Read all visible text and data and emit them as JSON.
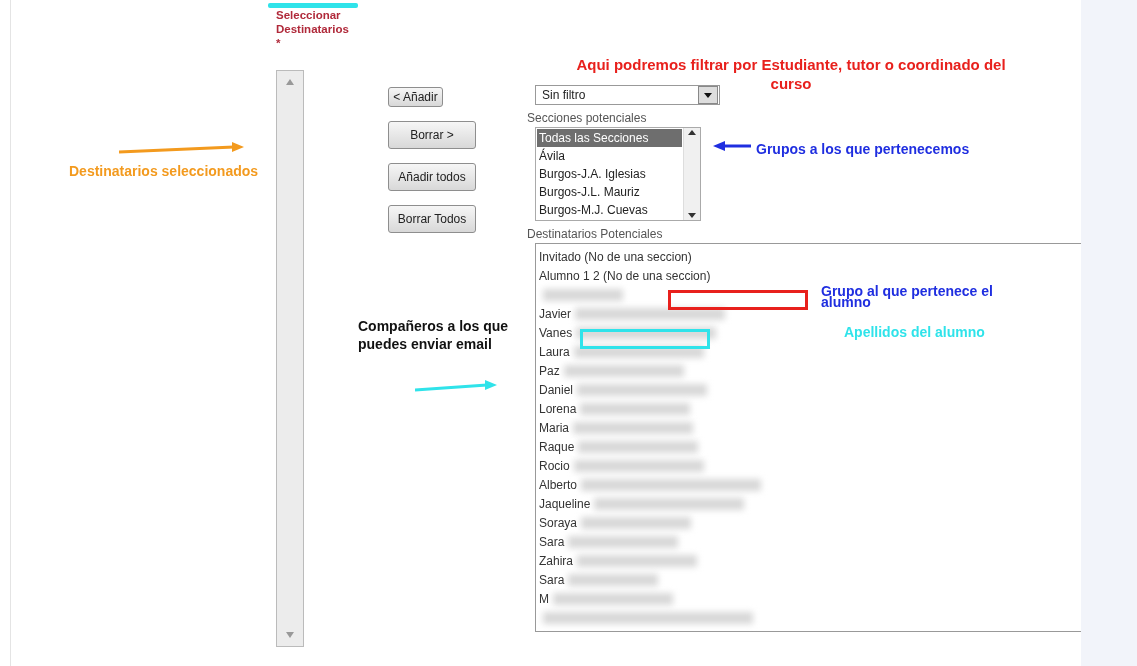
{
  "recipients_title": {
    "text": "Seleccionar Destinatarios",
    "required_mark": "*"
  },
  "selected_recipients": {
    "kind": "empty-list"
  },
  "buttons": [
    {
      "label": "< Añadir",
      "kind": "compact"
    },
    {
      "label": "Borrar >",
      "kind": "wide"
    },
    {
      "label": "Añadir todos",
      "kind": "wide"
    },
    {
      "label": "Borrar Todos",
      "kind": "wide"
    }
  ],
  "filter": {
    "value": "Sin filtro"
  },
  "sections_label": "Secciones potenciales",
  "sections": [
    {
      "label": "Todas las Secciones",
      "selected": true
    },
    {
      "label": "Ávila",
      "selected": false
    },
    {
      "label": "Burgos-J.A. Iglesias",
      "selected": false
    },
    {
      "label": "Burgos-J.L. Mauriz",
      "selected": false
    },
    {
      "label": "Burgos-M.J. Cuevas",
      "selected": false
    }
  ],
  "recipients_label": "Destinatarios Potenciales",
  "recipients": [
    {
      "name": "Invitado (No de una seccion)",
      "redacted": false
    },
    {
      "name": "Alumno 1 2 (No de una seccion)",
      "redacted": false
    },
    {
      "redacted": true
    },
    {
      "name": "Javier",
      "redacted": true
    },
    {
      "name": "Vanes",
      "redacted": true
    },
    {
      "name": "Laura",
      "redacted": true
    },
    {
      "name": "Paz",
      "redacted": true
    },
    {
      "name": "Daniel",
      "redacted": true
    },
    {
      "name": "Lorena",
      "redacted": true
    },
    {
      "name": "Maria",
      "redacted": true
    },
    {
      "name": "Raque",
      "redacted": true
    },
    {
      "name": "Rocio",
      "redacted": true
    },
    {
      "name": "Alberto",
      "redacted": true
    },
    {
      "name": "Jaqueline",
      "redacted": true
    },
    {
      "name": "Soraya",
      "redacted": true
    },
    {
      "name": "Sara",
      "redacted": true
    },
    {
      "name": "Zahira",
      "redacted": true
    },
    {
      "name": "Sara",
      "redacted": true
    },
    {
      "name": "M",
      "redacted": true
    },
    {
      "redacted": true
    }
  ],
  "annotations": [
    {
      "kind": "filter-note",
      "text": "Aqui podremos filtrar por Estudiante, tutor o coordinado del curso",
      "color": "#e8201c"
    },
    {
      "kind": "groups-note",
      "text": "Grupos a los que pertenecemos",
      "color": "#1f2ee0"
    },
    {
      "kind": "selected-note",
      "text": "Destinatarios seleccionados",
      "color": "#f39a1e"
    },
    {
      "kind": "group-of-student-note",
      "text": "Grupo al que pertenece el alumno",
      "color": "#1f2ee0"
    },
    {
      "kind": "classmates-note",
      "text": "Compañeros a los que puedes enviar email",
      "color": "#111111"
    },
    {
      "kind": "surnames-note",
      "text": "Apellidos del alumno",
      "color": "#2fe3ea"
    }
  ]
}
